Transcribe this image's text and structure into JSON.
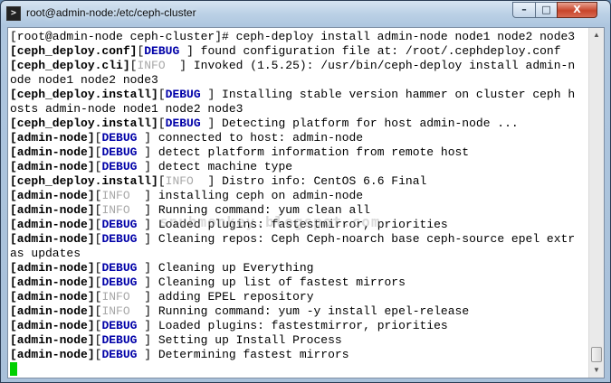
{
  "window": {
    "title": "root@admin-node:/etc/ceph-cluster",
    "icon": "terminal-icon",
    "controls": {
      "minimize": "–",
      "maximize": "□",
      "close": "X"
    }
  },
  "watermark": "snubmonkey.blogspot.com",
  "colors": {
    "debug": "#0000a8",
    "info": "#a8a8a8",
    "cursor": "#00d000"
  },
  "terminal": {
    "lines": [
      [
        [
          "",
          "[root@admin-node ceph-cluster]# ceph-deploy install admin-node node1 node2 node3"
        ]
      ],
      [
        [
          "b",
          "[ceph_deploy.conf]"
        ],
        [
          "",
          "["
        ],
        [
          "debug",
          "DEBUG"
        ],
        [
          "",
          " ] found configuration file at: /root/.cephdeploy.conf"
        ]
      ],
      [
        [
          "b",
          "[ceph_deploy.cli]"
        ],
        [
          "",
          "["
        ],
        [
          "info",
          "INFO"
        ],
        [
          "",
          "  ] Invoked (1.5.25): /usr/bin/ceph-deploy install admin-n"
        ]
      ],
      [
        [
          "",
          "ode node1 node2 node3"
        ]
      ],
      [
        [
          "b",
          "[ceph_deploy.install]"
        ],
        [
          "",
          "["
        ],
        [
          "debug",
          "DEBUG"
        ],
        [
          "",
          " ] Installing stable version hammer on cluster ceph h"
        ]
      ],
      [
        [
          "",
          "osts admin-node node1 node2 node3"
        ]
      ],
      [
        [
          "b",
          "[ceph_deploy.install]"
        ],
        [
          "",
          "["
        ],
        [
          "debug",
          "DEBUG"
        ],
        [
          "",
          " ] Detecting platform for host admin-node ..."
        ]
      ],
      [
        [
          "b",
          "[admin-node]"
        ],
        [
          "",
          "["
        ],
        [
          "debug",
          "DEBUG"
        ],
        [
          "",
          " ] connected to host: admin-node"
        ]
      ],
      [
        [
          "b",
          "[admin-node]"
        ],
        [
          "",
          "["
        ],
        [
          "debug",
          "DEBUG"
        ],
        [
          "",
          " ] detect platform information from remote host"
        ]
      ],
      [
        [
          "b",
          "[admin-node]"
        ],
        [
          "",
          "["
        ],
        [
          "debug",
          "DEBUG"
        ],
        [
          "",
          " ] detect machine type"
        ]
      ],
      [
        [
          "b",
          "[ceph_deploy.install]"
        ],
        [
          "",
          "["
        ],
        [
          "info",
          "INFO"
        ],
        [
          "",
          "  ] Distro info: CentOS 6.6 Final"
        ]
      ],
      [
        [
          "b",
          "[admin-node]"
        ],
        [
          "",
          "["
        ],
        [
          "info",
          "INFO"
        ],
        [
          "",
          "  ] installing ceph on admin-node"
        ]
      ],
      [
        [
          "b",
          "[admin-node]"
        ],
        [
          "",
          "["
        ],
        [
          "info",
          "INFO"
        ],
        [
          "",
          "  ] Running command: yum clean all"
        ]
      ],
      [
        [
          "b",
          "[admin-node]"
        ],
        [
          "",
          "["
        ],
        [
          "debug",
          "DEBUG"
        ],
        [
          "",
          " ] Loaded plugins: fastestmirror, priorities"
        ]
      ],
      [
        [
          "b",
          "[admin-node]"
        ],
        [
          "",
          "["
        ],
        [
          "debug",
          "DEBUG"
        ],
        [
          "",
          " ] Cleaning repos: Ceph Ceph-noarch base ceph-source epel extr"
        ]
      ],
      [
        [
          "",
          "as updates"
        ]
      ],
      [
        [
          "b",
          "[admin-node]"
        ],
        [
          "",
          "["
        ],
        [
          "debug",
          "DEBUG"
        ],
        [
          "",
          " ] Cleaning up Everything"
        ]
      ],
      [
        [
          "b",
          "[admin-node]"
        ],
        [
          "",
          "["
        ],
        [
          "debug",
          "DEBUG"
        ],
        [
          "",
          " ] Cleaning up list of fastest mirrors"
        ]
      ],
      [
        [
          "b",
          "[admin-node]"
        ],
        [
          "",
          "["
        ],
        [
          "info",
          "INFO"
        ],
        [
          "",
          "  ] adding EPEL repository"
        ]
      ],
      [
        [
          "b",
          "[admin-node]"
        ],
        [
          "",
          "["
        ],
        [
          "info",
          "INFO"
        ],
        [
          "",
          "  ] Running command: yum -y install epel-release"
        ]
      ],
      [
        [
          "b",
          "[admin-node]"
        ],
        [
          "",
          "["
        ],
        [
          "debug",
          "DEBUG"
        ],
        [
          "",
          " ] Loaded plugins: fastestmirror, priorities"
        ]
      ],
      [
        [
          "b",
          "[admin-node]"
        ],
        [
          "",
          "["
        ],
        [
          "debug",
          "DEBUG"
        ],
        [
          "",
          " ] Setting up Install Process"
        ]
      ],
      [
        [
          "b",
          "[admin-node]"
        ],
        [
          "",
          "["
        ],
        [
          "debug",
          "DEBUG"
        ],
        [
          "",
          " ] Determining fastest mirrors"
        ]
      ]
    ]
  },
  "scrollbar": {
    "up_arrow": "▲",
    "down_arrow": "▼"
  }
}
